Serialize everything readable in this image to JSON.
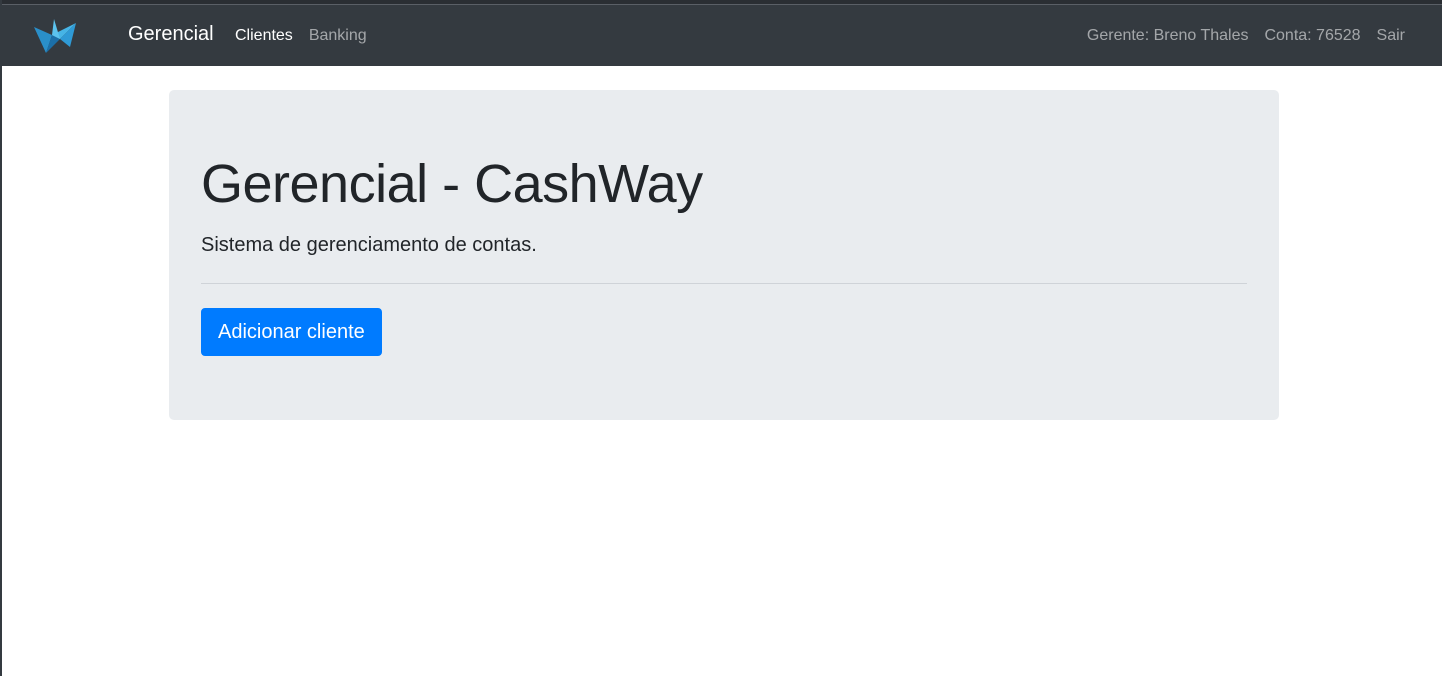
{
  "navbar": {
    "logo_icon": "paper-plane-logo-icon",
    "brand": "Gerencial",
    "links": [
      {
        "label": "Clientes",
        "active": true
      },
      {
        "label": "Banking",
        "active": false
      }
    ],
    "manager_label": "Gerente: Breno Thales",
    "account_label": "Conta: 76528",
    "logout_label": "Sair"
  },
  "jumbotron": {
    "title": "Gerencial - CashWay",
    "lead": "Sistema de gerenciamento de contas.",
    "add_button_label": "Adicionar cliente"
  },
  "colors": {
    "navbar_bg": "#343a40",
    "jumbotron_bg": "#e9ecef",
    "primary": "#007bff"
  }
}
